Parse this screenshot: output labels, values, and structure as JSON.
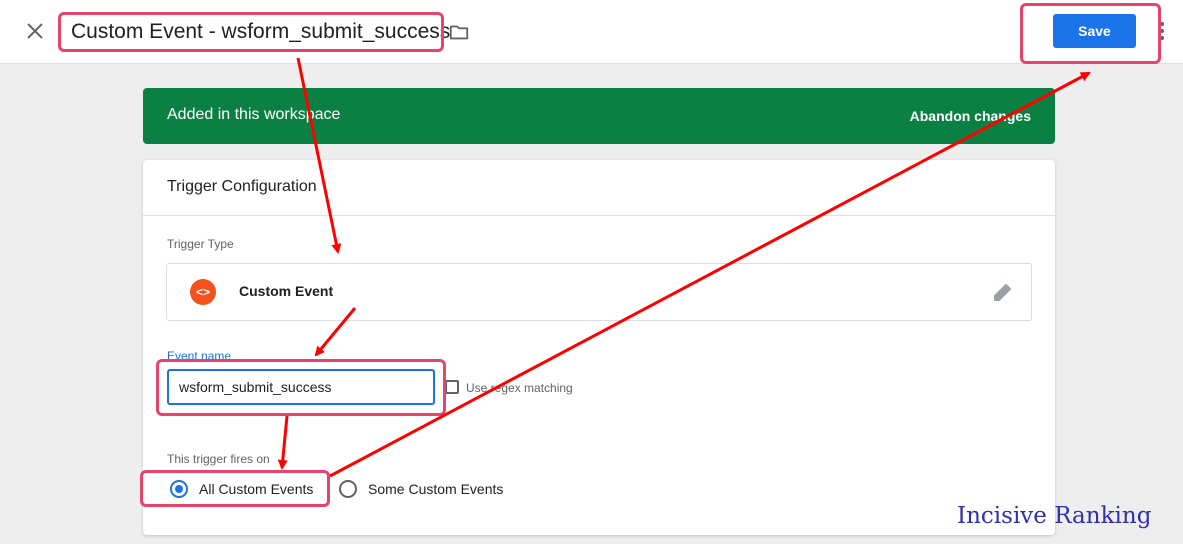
{
  "header": {
    "title": "Custom Event - wsform_submit_success",
    "save_label": "Save"
  },
  "banner": {
    "text": "Added in this workspace",
    "action_label": "Abandon changes"
  },
  "card": {
    "title": "Trigger Configuration",
    "trigger_type_label": "Trigger Type",
    "trigger_type_value": "Custom Event",
    "event_name_label": "Event name",
    "event_name_value": "wsform_submit_success",
    "regex_label": "Use regex matching",
    "fires_on_label": "This trigger fires on",
    "options": [
      {
        "label": "All Custom Events",
        "selected": true
      },
      {
        "label": "Some Custom Events",
        "selected": false
      }
    ]
  },
  "watermark": "Incisive Ranking",
  "colors": {
    "accent": "#1a73e8",
    "banner": "#0b8043",
    "highlight": "#e8436b",
    "arrow": "#ff0000"
  },
  "icons": [
    "close-icon",
    "folder-icon",
    "more-vert-icon",
    "code-icon",
    "pencil-icon"
  ]
}
